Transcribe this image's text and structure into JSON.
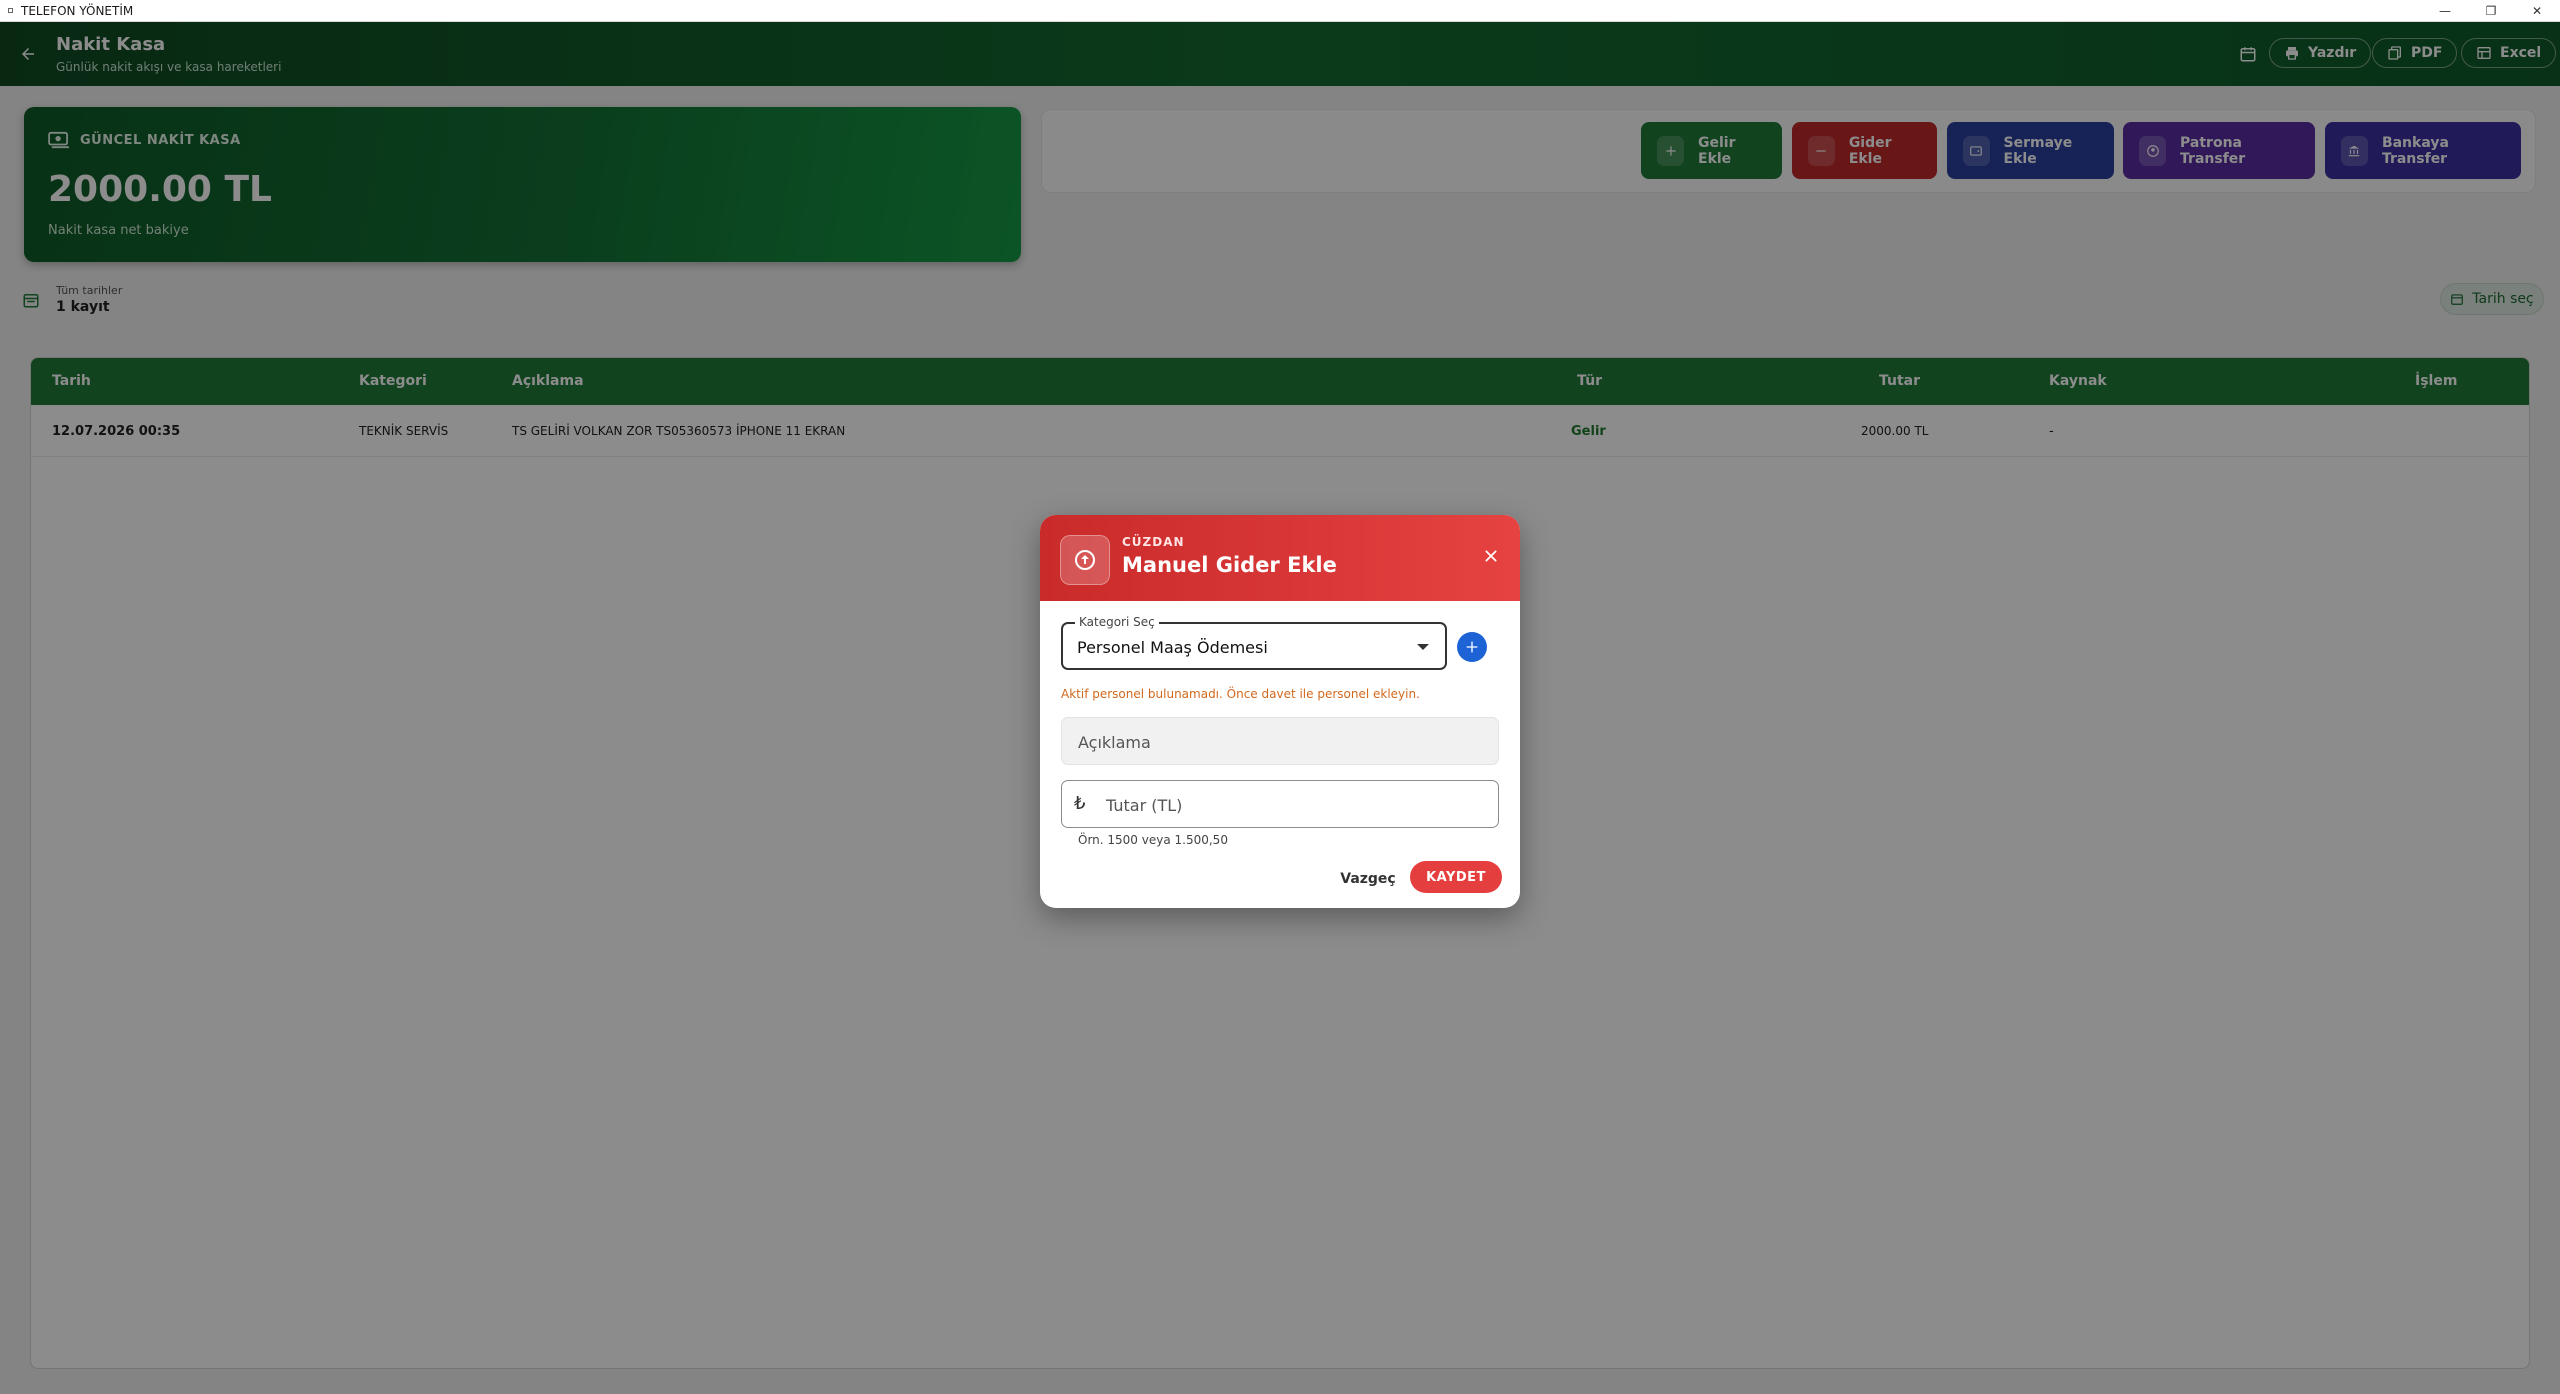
{
  "window": {
    "title": "TELEFON YÖNETİM",
    "controls": {
      "minimize": "—",
      "restore": "❐",
      "close": "✕"
    }
  },
  "appbar": {
    "title": "Nakit Kasa",
    "subtitle": "Günlük nakit akışı ve kasa hareketleri",
    "print_label": "Yazdır",
    "pdf_label": "PDF",
    "excel_label": "Excel"
  },
  "cash_card": {
    "label": "GÜNCEL NAKİT KASA",
    "amount": "2000.00 TL",
    "caption": "Nakit kasa net bakiye"
  },
  "actions": {
    "income": "Gelir Ekle",
    "expense": "Gider Ekle",
    "capital": "Sermaye Ekle",
    "owner_transfer": "Patrona Transfer",
    "bank_transfer": "Bankaya Transfer",
    "colors": {
      "income": "#1f7a3a",
      "expense": "#c0292b",
      "capital": "#2a3f9e",
      "owner_transfer": "#5a2fa3",
      "bank_transfer": "#3b32a0"
    }
  },
  "filter": {
    "range_label": "Tüm tarihler",
    "count_label": "1 kayıt",
    "date_button": "Tarih seç"
  },
  "table": {
    "headers": {
      "date": "Tarih",
      "category": "Kategori",
      "description": "Açıklama",
      "type": "Tür",
      "amount": "Tutar",
      "source": "Kaynak",
      "action": "İşlem"
    },
    "rows": [
      {
        "date": "12.07.2026 00:35",
        "category": "TEKNİK SERVİS",
        "description": "TS GELİRİ VOLKAN ZOR TS05360573 İPHONE 11 EKRAN",
        "type": "Gelir",
        "amount": "2000.00 TL",
        "source": "-"
      }
    ]
  },
  "dialog": {
    "kicker": "CÜZDAN",
    "title": "Manuel Gider Ekle",
    "category_label": "Kategori Seç",
    "category_value": "Personel Maaş Ödemesi",
    "warning": "Aktif personel bulunamadı. Önce davet ile personel ekleyin.",
    "description_placeholder": "Açıklama",
    "currency_symbol": "₺",
    "amount_placeholder": "Tutar (TL)",
    "amount_hint": "Örn. 1500 veya 1.500,50",
    "cancel_label": "Vazgeç",
    "save_label": "KAYDET"
  },
  "colors": {
    "brand_green": "#1e7a38",
    "income_text": "#1f7a2e",
    "danger": "#e53e3e",
    "warning": "#d2691e",
    "info_blue": "#1e63d6"
  }
}
